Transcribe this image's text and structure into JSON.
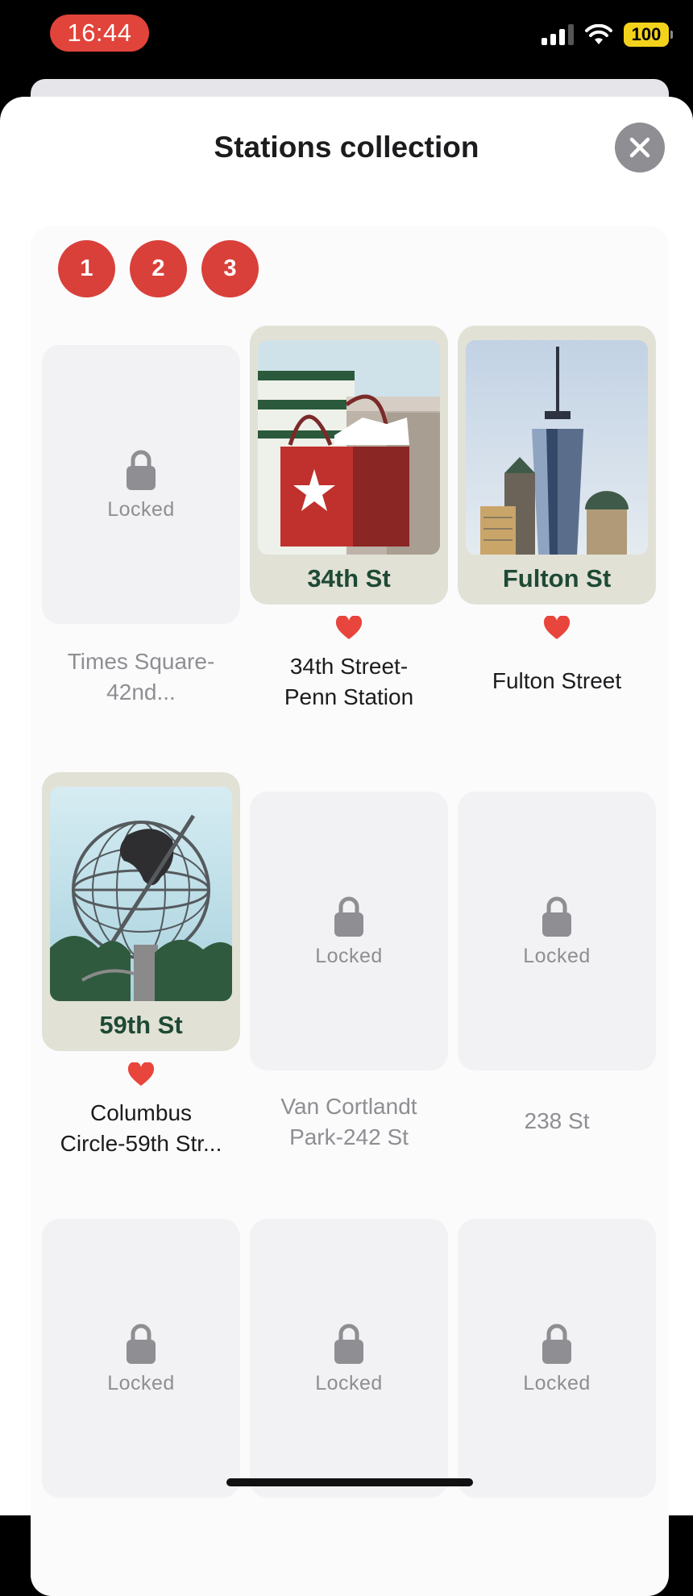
{
  "status_bar": {
    "time": "16:44",
    "battery": "100"
  },
  "sheet": {
    "title": "Stations collection"
  },
  "pages": [
    "1",
    "2",
    "3"
  ],
  "locked_text": "Locked",
  "stations": [
    {
      "name": "Times Square-42nd...",
      "locked": true
    },
    {
      "name": "34th Street-\nPenn Station",
      "locked": false,
      "card_title": "34th St",
      "favorite": true
    },
    {
      "name": "Fulton Street",
      "locked": false,
      "card_title": "Fulton St",
      "favorite": true
    },
    {
      "name": "Columbus\nCircle-59th Str...",
      "locked": false,
      "card_title": "59th St",
      "favorite": true
    },
    {
      "name": "Van Cortlandt\nPark-242 St",
      "locked": true
    },
    {
      "name": "238 St",
      "locked": true
    },
    {
      "name": "",
      "locked": true
    },
    {
      "name": "",
      "locked": true
    },
    {
      "name": "",
      "locked": true
    }
  ],
  "colors": {
    "accent": "#d9403a",
    "card_title": "#1e4a35",
    "heart": "#e8453c"
  }
}
